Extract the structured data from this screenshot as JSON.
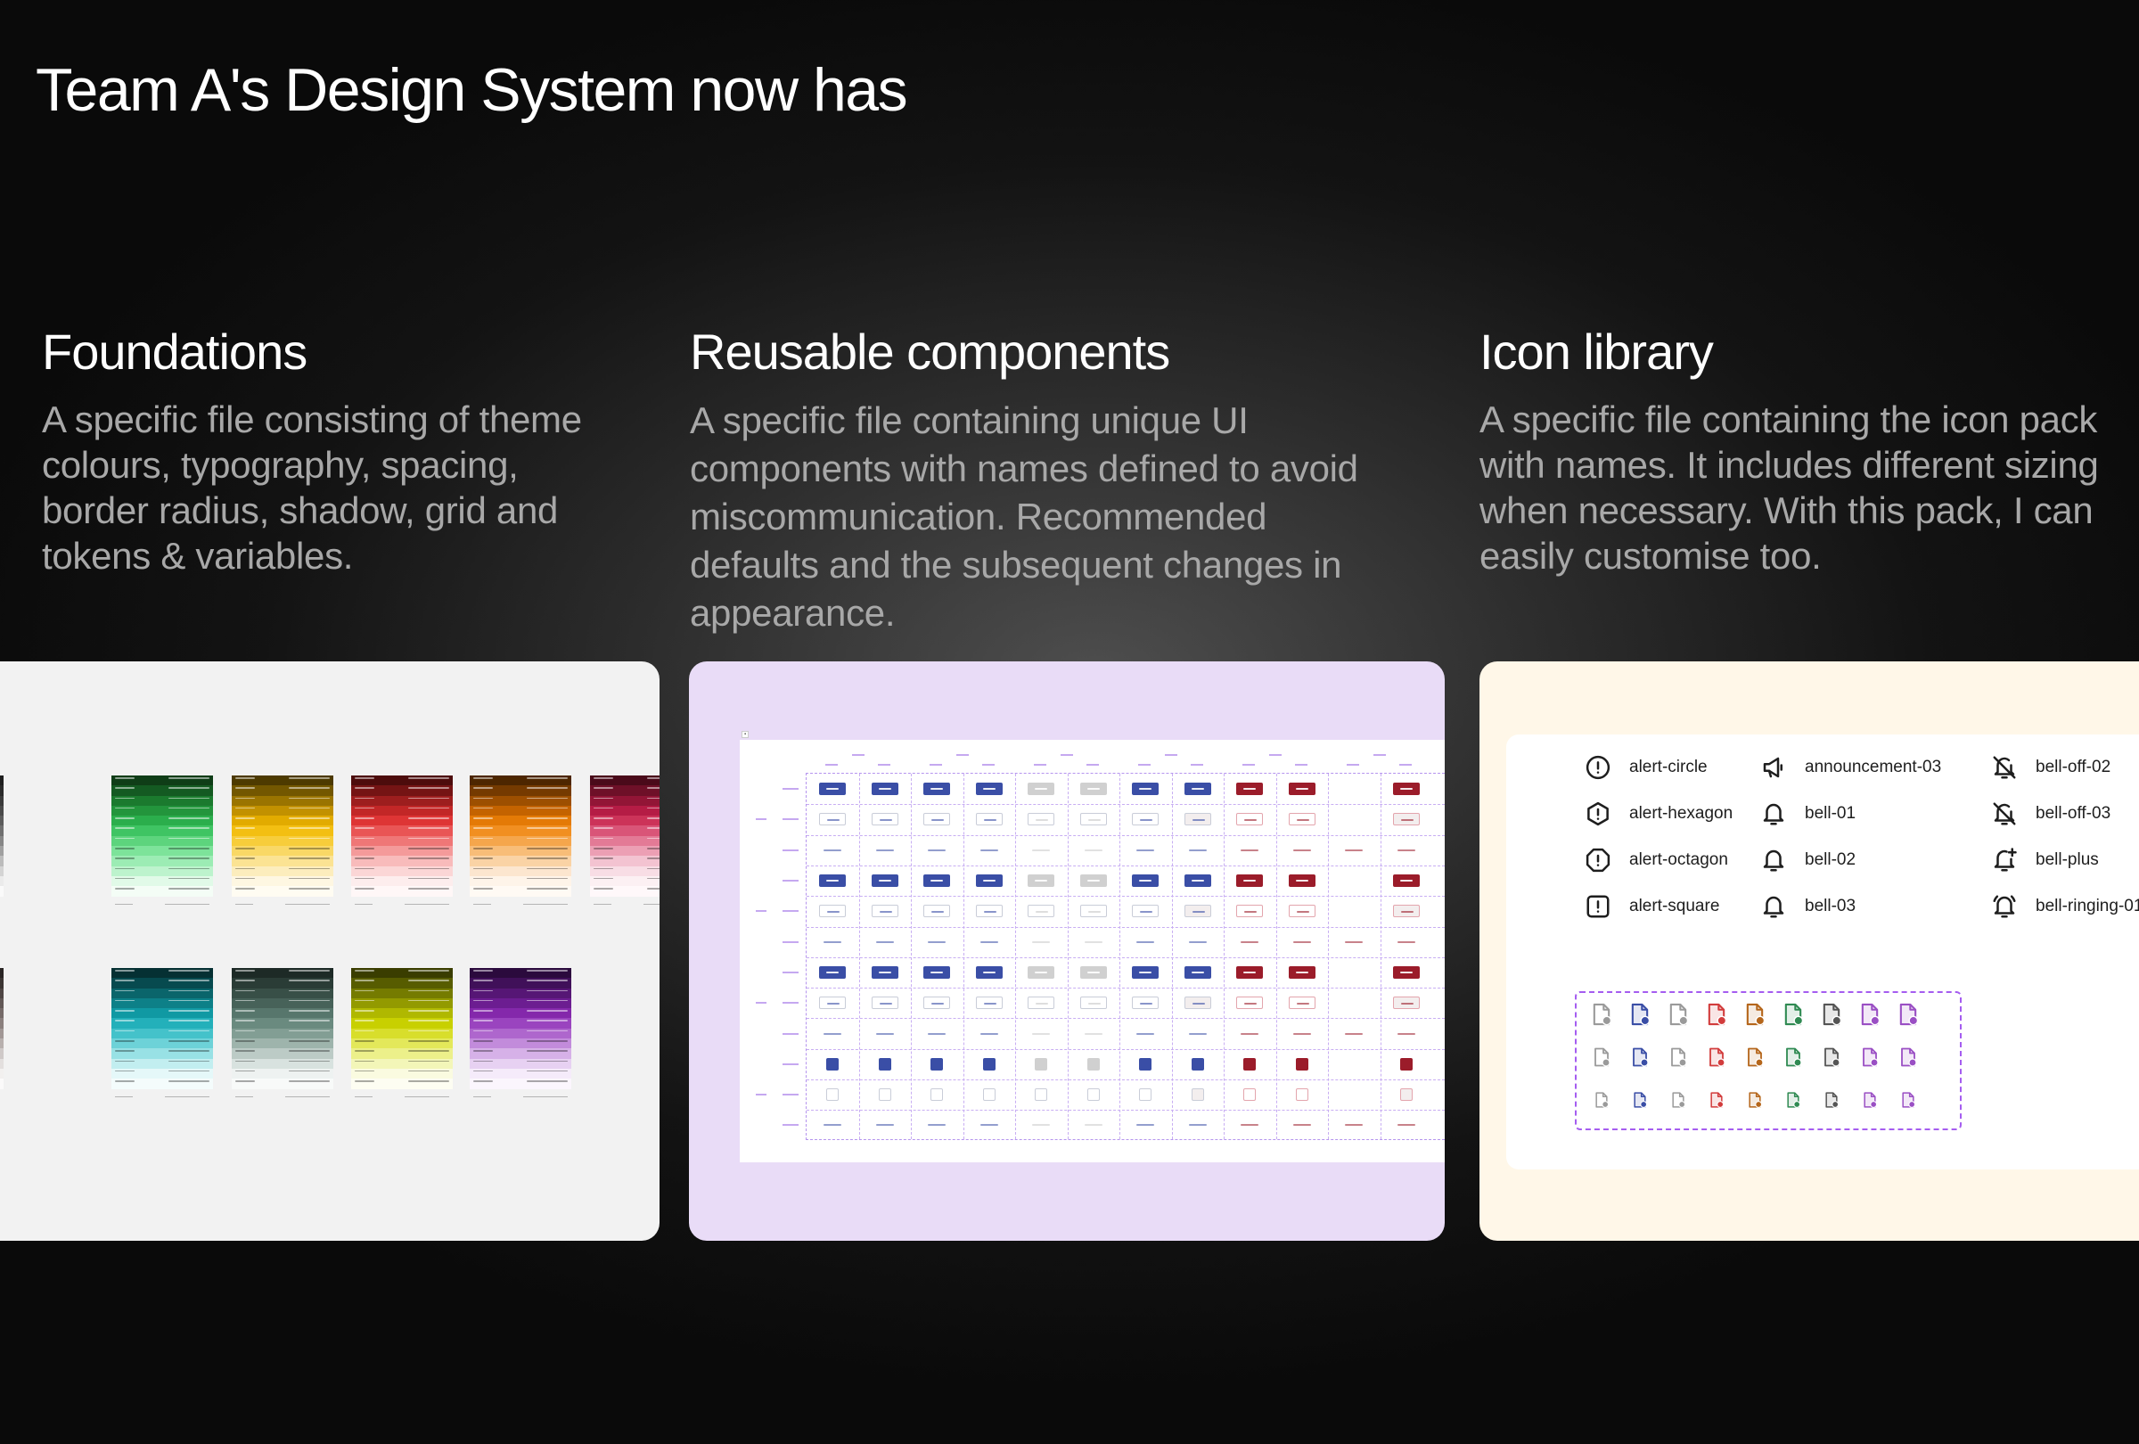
{
  "header": {
    "title": "Team A's Design System now has"
  },
  "sections": [
    {
      "title": "Foundations",
      "description": "A specific file consisting of theme colours, typography, spacing, border radius, shadow, grid and tokens & variables."
    },
    {
      "title": "Reusable components",
      "description": "A specific file containing unique UI components with names defined to avoid miscommunication. Recommended defaults and the subsequent changes in appearance."
    },
    {
      "title": "Icon library",
      "description": "A specific file containing the icon pack with names. It includes different sizing when necessary. With this pack, I can easily customise too."
    }
  ],
  "foundations": {
    "palettes": [
      {
        "family": "neutral",
        "colors": [
          "#1f1f1f",
          "#2b2b2b",
          "#3b3b3b",
          "#4a4a4a",
          "#5c5c5c",
          "#707070",
          "#878787",
          "#a0a0a0",
          "#bcbcbc",
          "#d4d4d4",
          "#ebebeb",
          "#fafafa"
        ]
      },
      {
        "family": "green",
        "colors": [
          "#0f3d17",
          "#145a22",
          "#1b7a2e",
          "#23953c",
          "#2bae4c",
          "#3fc463",
          "#5dd47d",
          "#7de39a",
          "#9cecb4",
          "#bdf3cd",
          "#e1fae8",
          "#f4fdf6"
        ]
      },
      {
        "family": "yellow",
        "colors": [
          "#4d3a00",
          "#735700",
          "#9a7400",
          "#c29100",
          "#e2ab00",
          "#f3bf12",
          "#f7cd3b",
          "#f9d866",
          "#fbe393",
          "#fcedbd",
          "#fef7e2",
          "#fffcf2"
        ]
      },
      {
        "family": "red",
        "colors": [
          "#4d0c0c",
          "#751414",
          "#9d1e1e",
          "#c22727",
          "#de3535",
          "#e95555",
          "#ef7777",
          "#f49a9a",
          "#f8bbbb",
          "#fbd6d6",
          "#fdeded",
          "#fff7f7"
        ]
      },
      {
        "family": "orange",
        "colors": [
          "#4d2600",
          "#753a00",
          "#9d4f00",
          "#c46300",
          "#e47a06",
          "#f18f21",
          "#f5a64c",
          "#f8bd78",
          "#fad3a5",
          "#fce6cf",
          "#fef4e9",
          "#fffaf4"
        ]
      },
      {
        "family": "crimson",
        "colors": [
          "#4a0a1a",
          "#6e1028",
          "#921536",
          "#b51c45",
          "#cc3359",
          "#d95578",
          "#e37a96",
          "#ec9fb4",
          "#f3c3d1",
          "#f8dde5",
          "#fcf0f3",
          "#fff8fa"
        ]
      },
      {
        "family": "taupe",
        "colors": [
          "#2a2524",
          "#3c3533",
          "#4f4644",
          "#625856",
          "#766b69",
          "#8b807e",
          "#a19795",
          "#b8b0ae",
          "#cfc9c8",
          "#e3dfde",
          "#f2f0ef",
          "#fbfafa"
        ]
      },
      {
        "family": "teal",
        "colors": [
          "#053033",
          "#074a4f",
          "#0a656b",
          "#0d8088",
          "#1099a3",
          "#23b0ba",
          "#44c2ca",
          "#6dd2d8",
          "#98e1e5",
          "#c2eef0",
          "#e5f8f9",
          "#f4fcfc"
        ]
      },
      {
        "family": "sage",
        "colors": [
          "#1d2a26",
          "#2a3c36",
          "#384f47",
          "#476259",
          "#57766c",
          "#6a8a7f",
          "#829e94",
          "#9eb4ac",
          "#bccbc6",
          "#d8e2df",
          "#eef2f1",
          "#f8faf9"
        ]
      },
      {
        "family": "lime",
        "colors": [
          "#3a3d00",
          "#575c00",
          "#757b00",
          "#939a00",
          "#b0b800",
          "#c8d000",
          "#d8de2b",
          "#e3e85a",
          "#ecf08a",
          "#f3f6b8",
          "#fafbe0",
          "#fdfdf2"
        ]
      },
      {
        "family": "purple",
        "colors": [
          "#2b0a3d",
          "#401059",
          "#561675",
          "#6c1d91",
          "#8428ab",
          "#9a44bf",
          "#ae66cd",
          "#c28bdb",
          "#d6b1e8",
          "#e7d1f2",
          "#f5ebfa",
          "#fbf6fd"
        ]
      }
    ]
  },
  "icons": {
    "list": [
      {
        "name": "alert-circle",
        "icon": "alert-circle-icon"
      },
      {
        "name": "alert-hexagon",
        "icon": "alert-hexagon-icon"
      },
      {
        "name": "alert-octagon",
        "icon": "alert-octagon-icon"
      },
      {
        "name": "alert-square",
        "icon": "alert-square-icon"
      },
      {
        "name": "announcement-03",
        "icon": "announcement-icon"
      },
      {
        "name": "bell-01",
        "icon": "bell-icon"
      },
      {
        "name": "bell-02",
        "icon": "bell-icon"
      },
      {
        "name": "bell-03",
        "icon": "bell-icon"
      },
      {
        "name": "bell-off-02",
        "icon": "bell-off-icon"
      },
      {
        "name": "bell-off-03",
        "icon": "bell-off-icon"
      },
      {
        "name": "bell-plus",
        "icon": "bell-plus-icon"
      },
      {
        "name": "bell-ringing-01",
        "icon": "bell-ringing-icon"
      }
    ],
    "file_variant_colors": [
      "#9a9a9a",
      "#3a4ea6",
      "#9a9a9a",
      "#d23c3c",
      "#b5661b",
      "#2f8a52",
      "#555555",
      "#9a4fc4",
      "#9a4fc4"
    ]
  },
  "components": {
    "colors": {
      "primary": "#3a4ea6",
      "neutral": "#c8c8c8",
      "danger": "#9b1c2a",
      "outline": "#c9cdd8",
      "grid": "#b594ee"
    }
  }
}
